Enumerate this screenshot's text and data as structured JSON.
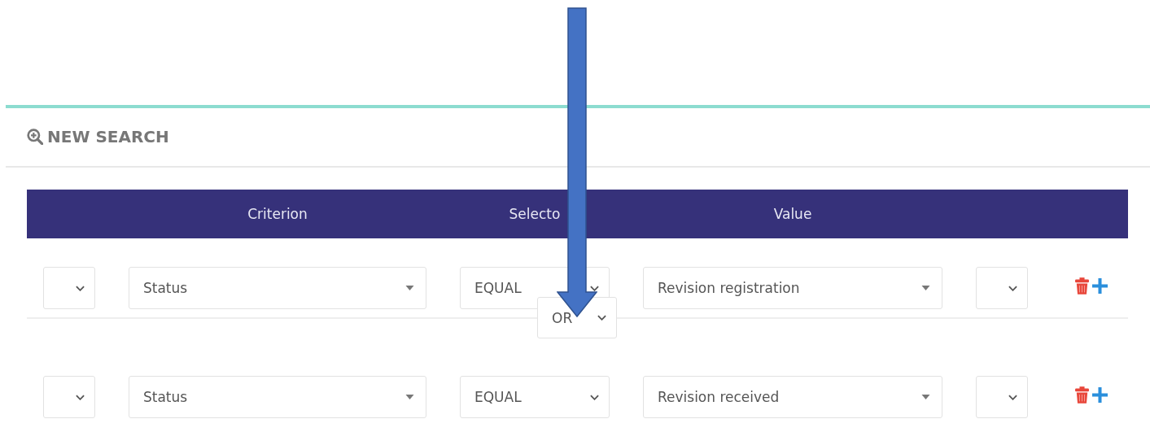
{
  "title": "NEW SEARCH",
  "table": {
    "columns": [
      "Criterion",
      "Selecto",
      "Value"
    ],
    "rows": [
      {
        "criterion": "Status",
        "selector": "EQUAL",
        "value": "Revision registration"
      },
      {
        "criterion": "Status",
        "selector": "EQUAL",
        "value": "Revision received"
      }
    ],
    "connectors": [
      {
        "operator": "OR"
      }
    ]
  },
  "annotation": {
    "kind": "arrow"
  }
}
